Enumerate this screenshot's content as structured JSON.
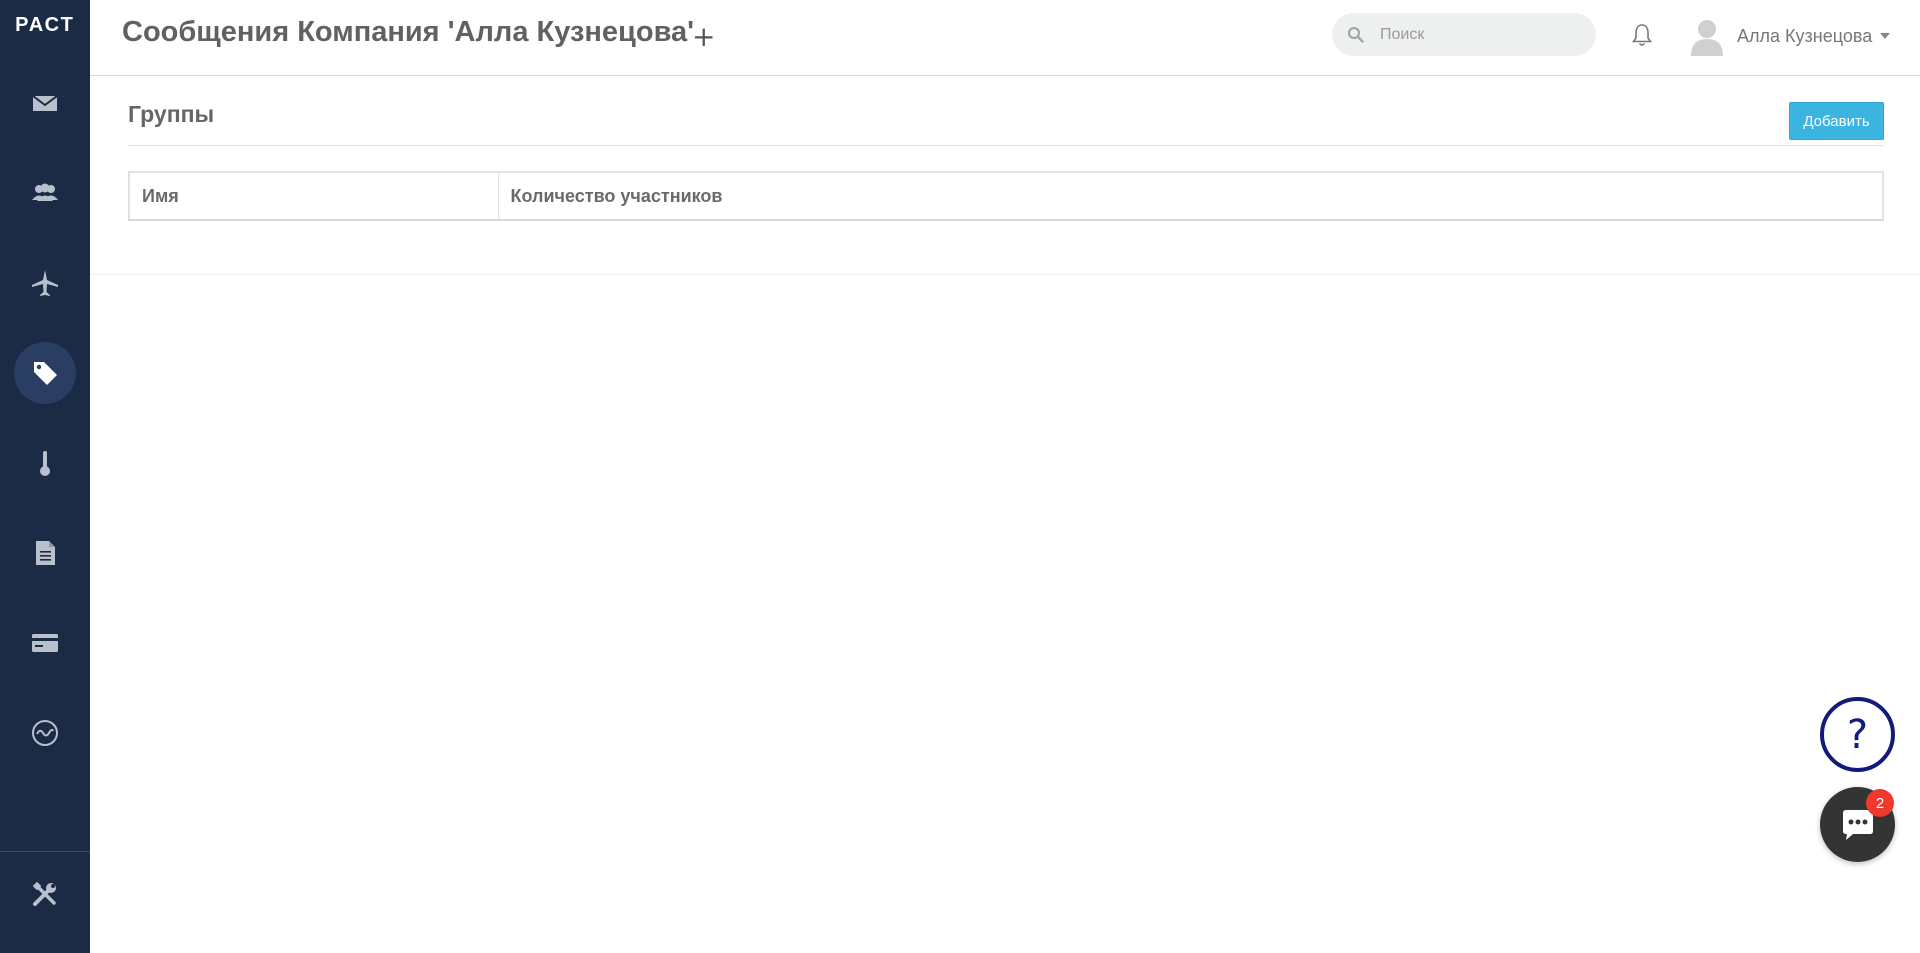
{
  "sidebar": {
    "logo": "РАСТ",
    "items": [
      {
        "icon": "envelope-icon"
      },
      {
        "icon": "users-icon"
      },
      {
        "icon": "airplane-icon"
      },
      {
        "icon": "tag-icon",
        "active": true
      },
      {
        "icon": "thermometer-icon"
      },
      {
        "icon": "document-icon"
      },
      {
        "icon": "credit-card-icon"
      },
      {
        "icon": "pulse-icon"
      }
    ],
    "settings_icon": "tools-icon"
  },
  "header": {
    "title": "Сообщения Компания 'Алла Кузнецова'",
    "add_tab": "+",
    "search_placeholder": "Поиск",
    "user_name": "Алла Кузнецова"
  },
  "section": {
    "title": "Группы",
    "add_button": "Добавить"
  },
  "table": {
    "columns": [
      "Имя",
      "Количество участников"
    ],
    "rows": []
  },
  "widgets": {
    "help_label": "?",
    "chat_badge": "2"
  },
  "colors": {
    "sidebar_bg": "#1b2a45",
    "active_nav": "#2a3d63",
    "accent": "#3cb4e2",
    "help_ring": "#121a7a",
    "badge": "#ee3a2e"
  }
}
